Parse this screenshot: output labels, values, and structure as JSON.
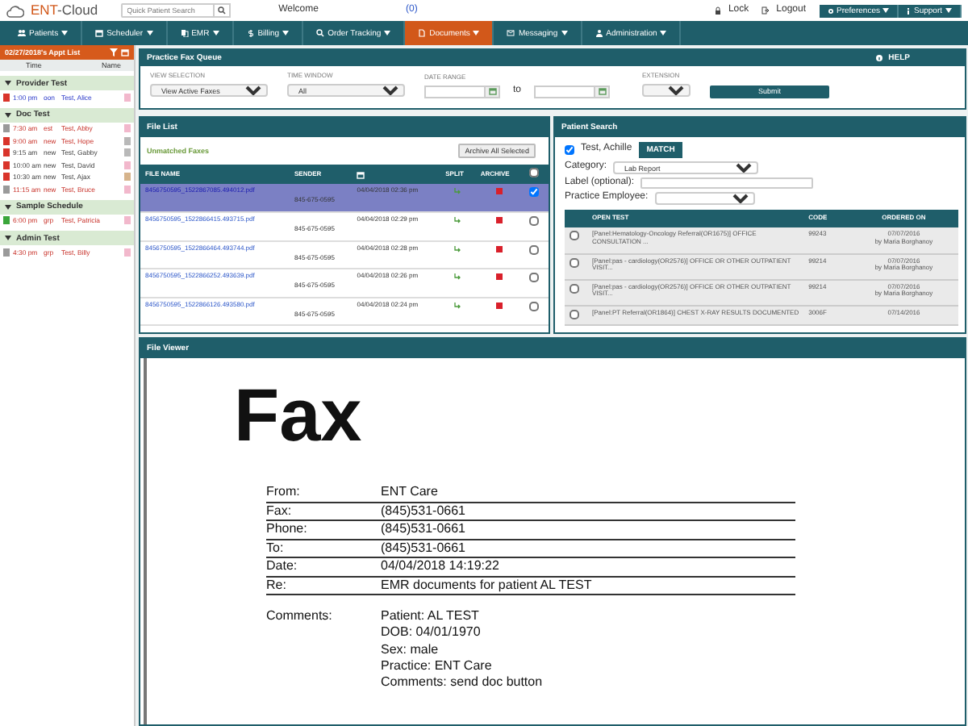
{
  "header": {
    "logo": [
      "ENT",
      "-Cloud"
    ],
    "search_placeholder": "Quick Patient Search",
    "welcome": "Welcome",
    "messages": "(0)",
    "lock": "Lock",
    "logout": "Logout",
    "menus": [
      "Preferences",
      "Support"
    ]
  },
  "nav": [
    {
      "label": "Patients",
      "selected": false
    },
    {
      "label": "Scheduler",
      "selected": false
    },
    {
      "label": "EMR",
      "selected": false
    },
    {
      "label": "Billing",
      "selected": false
    },
    {
      "label": "Order Tracking",
      "selected": false
    },
    {
      "label": "Documents",
      "selected": true
    },
    {
      "label": "Messaging",
      "selected": false
    },
    {
      "label": "Administration",
      "selected": false
    }
  ],
  "appt_list": {
    "title": "02/27/2018's Appt List",
    "columns": [
      "Time",
      "Name"
    ],
    "groups": [
      {
        "name": "Provider Test",
        "expanded": true,
        "rows": [
          {
            "time": "1:00 pm",
            "type": "oon",
            "patient": "Test, Alice",
            "color": "#d9342b",
            "tag": {
              "color": "#f2b8cc"
            },
            "kind": "provider"
          }
        ]
      },
      {
        "name": "Doc Test",
        "expanded": true,
        "rows": [
          {
            "time": "7:30 am",
            "type": "est",
            "patient": "Test, Abby",
            "color": "#9a9a9a",
            "tag": {
              "color": "#f2b8cc"
            },
            "kind": "alert"
          },
          {
            "time": "9:00 am",
            "type": "new",
            "patient": "Test, Hope",
            "color": "#d9342b",
            "tag": {
              "color": "#b9b9b9"
            },
            "kind": "alert"
          },
          {
            "time": "9:15 am",
            "type": "new",
            "patient": "Test, Gabby",
            "color": "#d9342b",
            "tag": {
              "color": "#b9b9b9"
            },
            "kind": "normal"
          },
          {
            "time": "10:00 am",
            "type": "new",
            "patient": "Test, David",
            "color": "#d9342b",
            "tag": {
              "color": "#f2b8cc"
            },
            "kind": "normal"
          },
          {
            "time": "10:30 am",
            "type": "new",
            "patient": "Test, Ajax",
            "color": "#d9342b",
            "tag": {
              "color": "#d6b48c"
            },
            "kind": "normal"
          },
          {
            "time": "11:15 am",
            "type": "new",
            "patient": "Test, Bruce",
            "color": "#9a9a9a",
            "tag": {
              "color": "#f2b8cc"
            },
            "kind": "alert"
          }
        ]
      },
      {
        "name": "Sample Schedule",
        "expanded": true,
        "rows": [
          {
            "time": "6:00 pm",
            "type": "grp",
            "patient": "Test, Patricia",
            "color": "#3aa63a",
            "tag": {
              "color": "#f2b8cc"
            },
            "kind": "alert"
          }
        ]
      },
      {
        "name": "Admin Test",
        "expanded": true,
        "rows": [
          {
            "time": "4:30 pm",
            "type": "grp",
            "patient": "Test, Billy",
            "color": "#9a9a9a",
            "tag": {
              "color": "#f2b8cc"
            },
            "kind": "alert"
          }
        ]
      }
    ]
  },
  "fax_queue": {
    "title": "Practice Fax Queue",
    "help": "HELP",
    "fields": [
      {
        "label": "VIEW SELECTION",
        "kind": "select",
        "value": "View Active Faxes"
      },
      {
        "label": "TIME WINDOW",
        "kind": "select",
        "value": "All"
      },
      {
        "label": "DATE RANGE",
        "kind": "daterange",
        "separator": "to"
      },
      {
        "label": "EXTENSION",
        "kind": "select"
      }
    ],
    "submit": "Submit"
  },
  "file_list": {
    "title": "File List",
    "subtitle": "Unmatched Faxes",
    "archive_button": "Archive All Selected",
    "columns": [
      "FILE NAME",
      "SENDER",
      "SPLIT",
      "ARCHIVE"
    ],
    "all_checked": false,
    "rows": [
      {
        "file": "8456750595_1522867085.494012.pdf",
        "sender": "845-675-0595",
        "date": "04/04/2018 02:36 pm",
        "selected": true
      },
      {
        "file": "8456750595_1522866415.493715.pdf",
        "sender": "845-675-0595",
        "date": "04/04/2018 02:29 pm",
        "selected": false
      },
      {
        "file": "8456750595_1522866464.493744.pdf",
        "sender": "845-675-0595",
        "date": "04/04/2018 02:28 pm",
        "selected": false
      },
      {
        "file": "8456750595_1522866252.493639.pdf",
        "sender": "845-675-0595",
        "date": "04/04/2018 02:26 pm",
        "selected": false
      },
      {
        "file": "8456750595_1522866126.493580.pdf",
        "sender": "845-675-0595",
        "date": "04/04/2018 02:24 pm",
        "selected": false
      }
    ]
  },
  "patient_search": {
    "title": "Patient Search",
    "patient": {
      "name": "Test, Achille",
      "checked": true
    },
    "match": "MATCH",
    "category_label": "Category:",
    "category": "Lab Report",
    "label_label": "Label (optional):",
    "employee_label": "Practice Employee:",
    "columns": [
      "OPEN TEST",
      "CODE",
      "ORDERED ON"
    ],
    "rows": [
      {
        "test": "[Panel:Hematology-Oncology Referral(OR1675)] OFFICE CONSULTATION ...",
        "code": "99243",
        "date": "07/07/2016",
        "by": "by Maria Borghanoy",
        "checked": false
      },
      {
        "test": "[Panel:pas - cardiology(OR2576)] OFFICE OR OTHER OUTPATIENT VISIT...",
        "code": "99214",
        "date": "07/07/2016",
        "by": "by Maria Borghanoy",
        "checked": false
      },
      {
        "test": "[Panel:pas - cardiology(OR2576)] OFFICE OR OTHER OUTPATIENT VISIT...",
        "code": "99214",
        "date": "07/07/2016",
        "by": "by Maria Borghanoy",
        "checked": false
      },
      {
        "test": "[Panel:PT Referral(OR1864)] CHEST X-RAY RESULTS DOCUMENTED",
        "code": "3006F",
        "date": "07/14/2016",
        "checked": false
      }
    ]
  },
  "file_viewer": {
    "title": "File Viewer",
    "heading": "Fax",
    "fields": [
      {
        "label": "From:",
        "value": "ENT Care"
      },
      {
        "label": "Fax:",
        "value": "(845)531-0661"
      },
      {
        "label": "Phone:",
        "value": "(845)531-0661"
      },
      {
        "label": "To:",
        "value": "(845)531-0661"
      },
      {
        "label": "Date:",
        "value": "04/04/2018 14:19:22"
      },
      {
        "label": "Re:",
        "value": "EMR documents for patient AL TEST"
      }
    ],
    "comments_label": "Comments:",
    "comments": [
      "Patient: AL TEST",
      "DOB: 04/01/1970",
      "Sex: male",
      "Practice: ENT Care",
      "Comments: send doc button"
    ]
  }
}
